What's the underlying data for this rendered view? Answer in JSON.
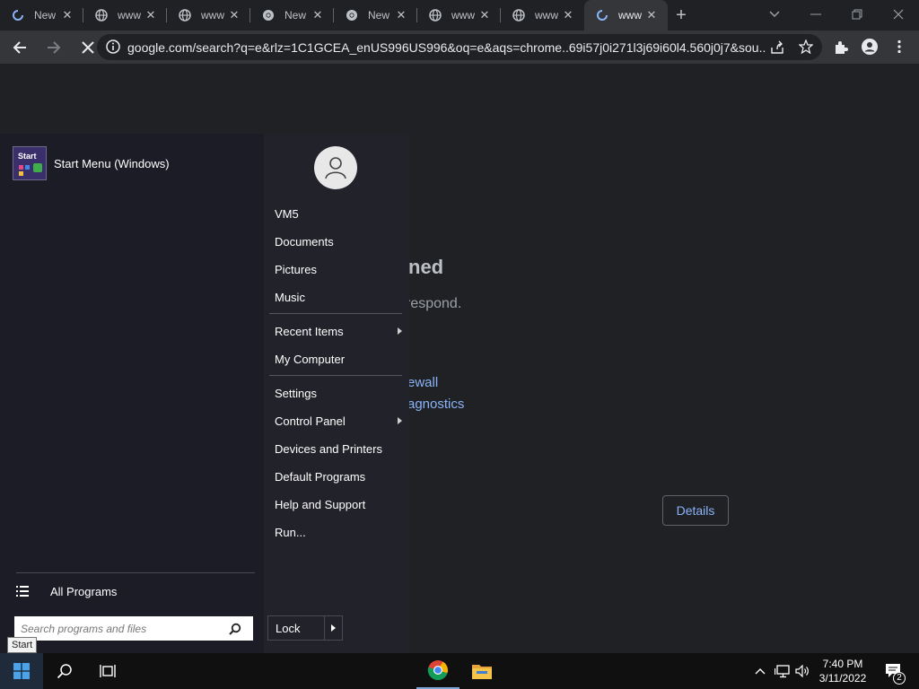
{
  "browser": {
    "tabs": [
      {
        "title": "New",
        "favicon": "loading-icon",
        "active": false
      },
      {
        "title": "www",
        "favicon": "globe-icon",
        "active": false
      },
      {
        "title": "www",
        "favicon": "globe-icon",
        "active": false
      },
      {
        "title": "New",
        "favicon": "chrome-icon",
        "active": false
      },
      {
        "title": "New",
        "favicon": "chrome-icon",
        "active": false
      },
      {
        "title": "www",
        "favicon": "globe-icon",
        "active": false
      },
      {
        "title": "www",
        "favicon": "globe-icon",
        "active": false
      },
      {
        "title": "www",
        "favicon": "loading-icon",
        "active": true
      }
    ],
    "url": "google.com/search?q=e&rlz=1C1GCEA_enUS996US996&oq=e&aqs=chrome..69i57j0i271l3j69i60l4.560j0j7&sou..."
  },
  "page": {
    "heading_fragment": "ned",
    "text_fragment": "respond.",
    "link1_fragment": "ewall",
    "link2_fragment": "agnostics",
    "details_label": "Details"
  },
  "start_menu": {
    "pinned_label": "Start Menu (Windows)",
    "pinned_icon_text": "Start",
    "user_items": [
      "VM5",
      "Documents",
      "Pictures",
      "Music"
    ],
    "recent_items": "Recent Items",
    "my_computer": "My Computer",
    "system_items": [
      "Settings",
      "Control Panel",
      "Devices and Printers",
      "Default Programs",
      "Help and Support",
      "Run..."
    ],
    "all_programs": "All Programs",
    "search_placeholder": "Search programs and files",
    "lock_label": "Lock",
    "tooltip": "Start"
  },
  "taskbar": {
    "time": "7:40 PM",
    "date": "3/11/2022",
    "notification_count": "2"
  },
  "colors": {
    "accent_link": "#8ab4f8",
    "windows_blue": "#0078d7",
    "background": "#202124"
  }
}
